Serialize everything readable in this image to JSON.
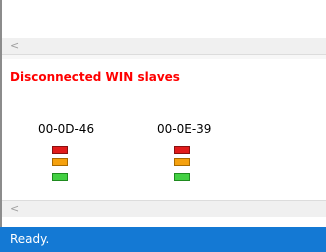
{
  "panel": {
    "title": "Disconnected WIN slaves"
  },
  "devices": [
    {
      "name": "00-0D-46",
      "leds": [
        "red",
        "orange",
        "green"
      ]
    },
    {
      "name": "00-0E-39",
      "leds": [
        "red",
        "orange",
        "green"
      ]
    }
  ],
  "scrollbars": {
    "left_arrow": "<"
  },
  "status": {
    "text": "Ready."
  },
  "colors": {
    "title": "#ff0000",
    "status_bar": "#1479d4",
    "led_red": "#e11b1b",
    "led_orange": "#f5a10e",
    "led_green": "#43d043"
  }
}
